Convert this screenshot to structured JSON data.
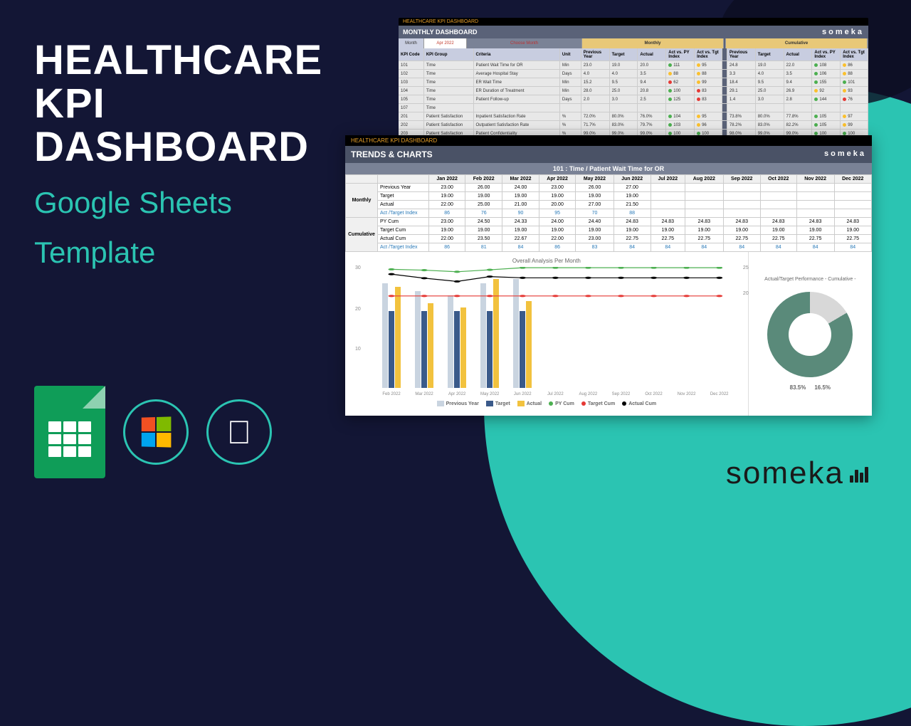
{
  "hero": {
    "title1": "HEALTHCARE",
    "title2": "KPI",
    "title3": "DASHBOARD",
    "sub1": "Google Sheets",
    "sub2": "Template"
  },
  "brand": "someka",
  "ss1": {
    "badge": "HEALTHCARE KPI DASHBOARD",
    "heading": "MONTHLY DASHBOARD",
    "month_lbl": "Month",
    "month_val": "Apr 2022",
    "choose": "Choose Month",
    "grp_monthly": "Monthly",
    "grp_cumulative": "Cumulative",
    "cols": [
      "KPI Code",
      "KPI Group",
      "Criteria",
      "Unit",
      "Previous Year",
      "Target",
      "Actual",
      "Act vs. PY Index",
      "Act vs. Tgt Index",
      "Previous Year",
      "Target",
      "Actual",
      "Act vs. PY Index",
      "Act vs. Tgt Index"
    ],
    "rows": [
      {
        "c": [
          "101",
          "Time",
          "Patient Wait Time for OR",
          "Min",
          "23.0",
          "19.0",
          "20.0",
          "111",
          "95",
          "24.8",
          "19.0",
          "22.0",
          "108",
          "86"
        ]
      },
      {
        "c": [
          "102",
          "Time",
          "Average Hospital Stay",
          "Days",
          "4.0",
          "4.0",
          "3.5",
          "88",
          "88",
          "3.3",
          "4.0",
          "3.5",
          "106",
          "88"
        ]
      },
      {
        "c": [
          "103",
          "Time",
          "ER Wait Time",
          "Min",
          "15.2",
          "9.5",
          "9.4",
          "62",
          "99",
          "18.4",
          "9.5",
          "9.4",
          "155",
          "101"
        ]
      },
      {
        "c": [
          "104",
          "Time",
          "ER Duration of Treatment",
          "Min",
          "28.0",
          "25.0",
          "20.8",
          "100",
          "83",
          "29.1",
          "25.0",
          "26.9",
          "92",
          "93"
        ]
      },
      {
        "c": [
          "105",
          "Time",
          "Patient Follow-up",
          "Days",
          "2.0",
          "3.0",
          "2.5",
          "125",
          "83",
          "1.4",
          "3.0",
          "2.8",
          "144",
          "76"
        ]
      },
      {
        "c": [
          "107",
          "Time",
          "",
          "",
          "",
          "",
          "",
          "",
          "",
          "",
          "",
          "",
          "",
          ""
        ]
      },
      {
        "c": [
          "201",
          "Patient Satisfaction",
          "Inpatient Satisfaction Rate",
          "%",
          "72.0%",
          "80.0%",
          "76.0%",
          "104",
          "95",
          "73.8%",
          "80.0%",
          "77.8%",
          "105",
          "97"
        ]
      },
      {
        "c": [
          "202",
          "Patient Satisfaction",
          "Outpatient Satisfaction Rate",
          "%",
          "71.7%",
          "83.0%",
          "79.7%",
          "103",
          "96",
          "78.2%",
          "83.0%",
          "82.2%",
          "105",
          "99"
        ]
      },
      {
        "c": [
          "203",
          "Patient Satisfaction",
          "Patient Confidentiality",
          "%",
          "99.0%",
          "99.0%",
          "99.0%",
          "100",
          "100",
          "98.0%",
          "99.0%",
          "99.0%",
          "100",
          "100"
        ]
      }
    ]
  },
  "ss2": {
    "badge": "HEALTHCARE KPI DASHBOARD",
    "heading": "TRENDS & CHARTS",
    "subtitle": "101 : Time  / Patient Wait Time for OR",
    "months": [
      "Jan 2022",
      "Feb 2022",
      "Mar 2022",
      "Apr 2022",
      "May 2022",
      "Jun 2022",
      "Jul 2022",
      "Aug 2022",
      "Sep 2022",
      "Oct 2022",
      "Nov 2022",
      "Dec 2022"
    ],
    "rgroup1": "Monthly",
    "rgroup2": "Cumulative",
    "r_prev": "Previous Year",
    "r_tgt": "Target",
    "r_act": "Actual",
    "r_idx": "Act /Target Index",
    "r_pycum": "PY Cum",
    "r_tgtcum": "Target Cum",
    "r_actcum": "Actual Cum",
    "monthly": {
      "prev": [
        "23.00",
        "26.00",
        "24.00",
        "23.00",
        "26.00",
        "27.00",
        "",
        "",
        "",
        "",
        "",
        ""
      ],
      "tgt": [
        "19.00",
        "19.00",
        "19.00",
        "19.00",
        "19.00",
        "19.00",
        "",
        "",
        "",
        "",
        "",
        ""
      ],
      "act": [
        "22.00",
        "25.00",
        "21.00",
        "20.00",
        "27.00",
        "21.50",
        "",
        "",
        "",
        "",
        "",
        ""
      ],
      "idx": [
        "86",
        "76",
        "90",
        "95",
        "70",
        "88",
        "",
        "",
        "",
        "",
        "",
        ""
      ]
    },
    "cum": {
      "py": [
        "23.00",
        "24.50",
        "24.33",
        "24.00",
        "24.40",
        "24.83",
        "24.83",
        "24.83",
        "24.83",
        "24.83",
        "24.83",
        "24.83"
      ],
      "tgt": [
        "19.00",
        "19.00",
        "19.00",
        "19.00",
        "19.00",
        "19.00",
        "19.00",
        "19.00",
        "19.00",
        "19.00",
        "19.00",
        "19.00"
      ],
      "act": [
        "22.00",
        "23.50",
        "22.67",
        "22.00",
        "23.00",
        "22.75",
        "22.75",
        "22.75",
        "22.75",
        "22.75",
        "22.75",
        "22.75"
      ],
      "idx": [
        "86",
        "81",
        "84",
        "86",
        "83",
        "84",
        "84",
        "84",
        "84",
        "84",
        "84",
        "84"
      ]
    }
  },
  "chart_data": [
    {
      "type": "bar",
      "title": "Overall Analysis Per Month",
      "categories": [
        "Feb 2022",
        "Mar 2022",
        "Apr 2022",
        "May 2022",
        "Jun 2022",
        "Jul 2022",
        "Aug 2022",
        "Sep 2022",
        "Oct 2022",
        "Nov 2022",
        "Dec 2022"
      ],
      "ylim_left": [
        0,
        30
      ],
      "yticks_left": [
        10,
        20,
        30
      ],
      "ylim_right": [
        0,
        25
      ],
      "yticks_right": [
        20,
        25
      ],
      "series": [
        {
          "name": "Previous Year",
          "type": "bar",
          "color": "#c9d4e0",
          "values": [
            26,
            24,
            23,
            26,
            27,
            null,
            null,
            null,
            null,
            null,
            null
          ]
        },
        {
          "name": "Target",
          "type": "bar",
          "color": "#3a5a8a",
          "values": [
            19,
            19,
            19,
            19,
            19,
            null,
            null,
            null,
            null,
            null,
            null
          ]
        },
        {
          "name": "Actual",
          "type": "bar",
          "color": "#f2c23e",
          "values": [
            25,
            21,
            20,
            27,
            21.5,
            null,
            null,
            null,
            null,
            null,
            null
          ]
        },
        {
          "name": "PY Cum",
          "type": "line",
          "color": "#4caf50",
          "values": [
            24.5,
            24.33,
            24.0,
            24.4,
            24.83,
            24.83,
            24.83,
            24.83,
            24.83,
            24.83,
            24.83
          ]
        },
        {
          "name": "Target Cum",
          "type": "line",
          "color": "#e53935",
          "values": [
            19,
            19,
            19,
            19,
            19,
            19,
            19,
            19,
            19,
            19,
            19
          ]
        },
        {
          "name": "Actual Cum",
          "type": "line",
          "color": "#000",
          "values": [
            23.5,
            22.67,
            22.0,
            23.0,
            22.75,
            22.75,
            22.75,
            22.75,
            22.75,
            22.75,
            22.75
          ]
        }
      ],
      "legend": [
        "Previous Year",
        "Target",
        "Actual",
        "PY Cum",
        "Target Cum",
        "Actual Cum"
      ]
    },
    {
      "type": "pie",
      "title": "Actual/Target Performance - Cumulative -",
      "series": [
        {
          "name": "83.5%",
          "value": 83.5,
          "color": "#5a8a7a"
        },
        {
          "name": "16.5%",
          "value": 16.5,
          "color": "#d8d8d8"
        }
      ],
      "legend": [
        "83.5%",
        "16.5%"
      ]
    }
  ]
}
